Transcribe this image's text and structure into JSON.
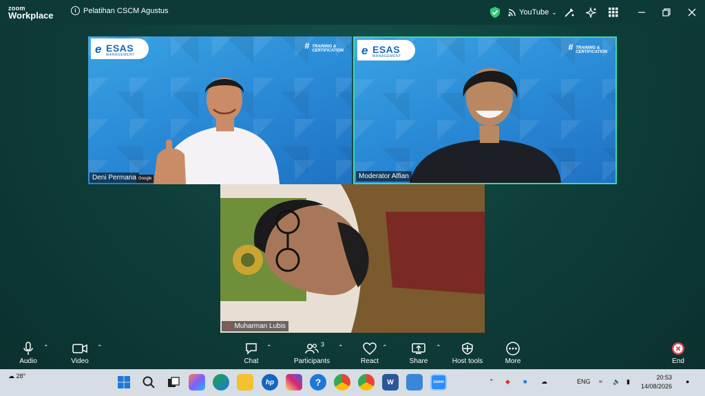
{
  "app": {
    "brand_top": "zoom",
    "brand_bottom": "Workplace"
  },
  "meeting": {
    "title": "Pelatihan CSCM Agustus",
    "stream_label": "YouTube"
  },
  "participants": [
    {
      "name": "Deni Permana",
      "badge": "Google"
    },
    {
      "name": "Moderator Alfian"
    },
    {
      "name": "Muharman Lubis",
      "muted": true
    }
  ],
  "branding": {
    "logo_word": "ESAS",
    "logo_sub": "MANAGEMENT",
    "tag_line1": "TRAINING &",
    "tag_line2": "CERTIFICATION"
  },
  "controls": {
    "audio": "Audio",
    "video": "Video",
    "chat": "Chat",
    "participants": "Participants",
    "participants_count": "3",
    "react": "React",
    "share": "Share",
    "host_tools": "Host tools",
    "more": "More",
    "end": "End"
  },
  "taskbar": {
    "temperature": "28°",
    "language": "ENG",
    "time": "20:53",
    "date": "14/08/2026"
  },
  "colors": {
    "background": "#0f3f3b",
    "active_speaker_border": "#3fd8a9",
    "tile_blue": "#2a8ad6",
    "end_red": "#e0454f"
  }
}
